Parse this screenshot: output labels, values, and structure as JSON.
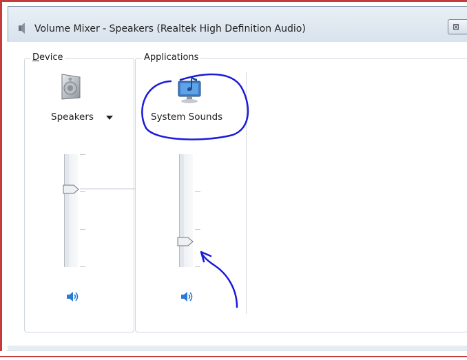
{
  "window": {
    "title": "Volume Mixer - Speakers (Realtek High Definition Audio)",
    "close_glyph": "⊠",
    "title_icon": "speaker-icon"
  },
  "device": {
    "group_label": "Device",
    "name": "Speakers",
    "icon": "speaker-device-icon",
    "volume_fraction": 0.69,
    "mute_icon": "volume-icon"
  },
  "applications": {
    "group_label": "Applications",
    "items": [
      {
        "name": "System Sounds",
        "icon": "system-sounds-icon",
        "volume_fraction": 0.23,
        "mute_icon": "volume-icon"
      }
    ]
  },
  "colors": {
    "frame": "#c43b3b",
    "annotation_ink": "#1a1adb",
    "volume_icon": "#2a7bd6"
  }
}
